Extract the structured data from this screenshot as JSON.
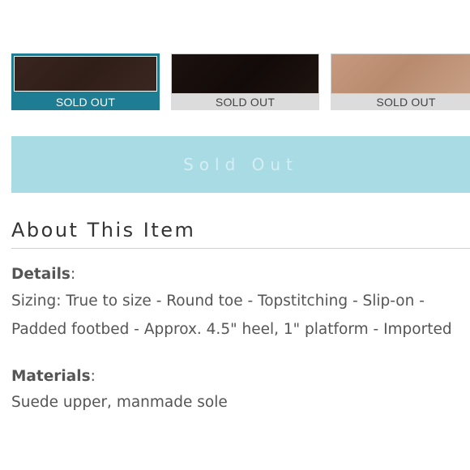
{
  "swatches": [
    {
      "label": "SOLD OUT",
      "selected": true,
      "color": "#34221d"
    },
    {
      "label": "SOLD OUT",
      "selected": false,
      "color": "#170e0b"
    },
    {
      "label": "SOLD OUT",
      "selected": false,
      "color": "#c2967b"
    }
  ],
  "accent_color": "#1e7c93",
  "buy_button": {
    "label": "Sold Out",
    "color": "#a9dbe5"
  },
  "about": {
    "title": "About This Item",
    "details": {
      "heading": "Details",
      "colon": ":",
      "line1": "Sizing: True to size - Round toe - Topstitching - Slip-on -",
      "line2": "Padded footbed - Approx. 4.5\" heel, 1\" platform - Imported"
    },
    "materials": {
      "heading": "Materials",
      "colon": ":",
      "text": "Suede upper, manmade sole"
    }
  }
}
